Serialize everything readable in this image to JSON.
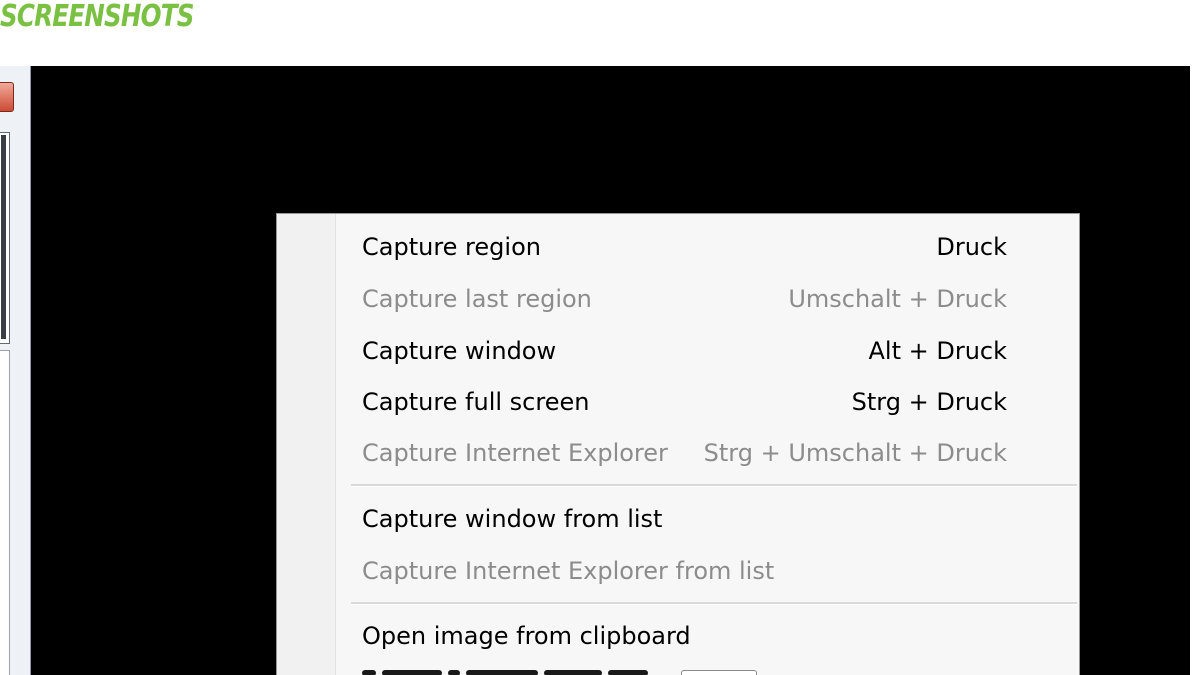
{
  "heading": "SCREENSHOTS",
  "colors": {
    "heading": "#7ac143",
    "screen_background": "#000000",
    "menu_background": "#f7f7f7",
    "enabled_text": "#000000",
    "disabled_text": "#8c8c8c"
  },
  "menu": {
    "items": [
      {
        "label": "Capture region",
        "shortcut": "Druck",
        "enabled": true
      },
      {
        "label": "Capture last region",
        "shortcut": "Umschalt + Druck",
        "enabled": false
      },
      {
        "label": "Capture window",
        "shortcut": "Alt + Druck",
        "enabled": true
      },
      {
        "label": "Capture full screen",
        "shortcut": "Strg + Druck",
        "enabled": true
      },
      {
        "label": "Capture Internet Explorer",
        "shortcut": "Strg + Umschalt + Druck",
        "enabled": false
      },
      {
        "label": "Capture window from list",
        "shortcut": "",
        "enabled": true
      },
      {
        "label": "Capture Internet Explorer from list",
        "shortcut": "",
        "enabled": false
      },
      {
        "label": "Open image from clipboard",
        "shortcut": "",
        "enabled": true
      }
    ]
  }
}
